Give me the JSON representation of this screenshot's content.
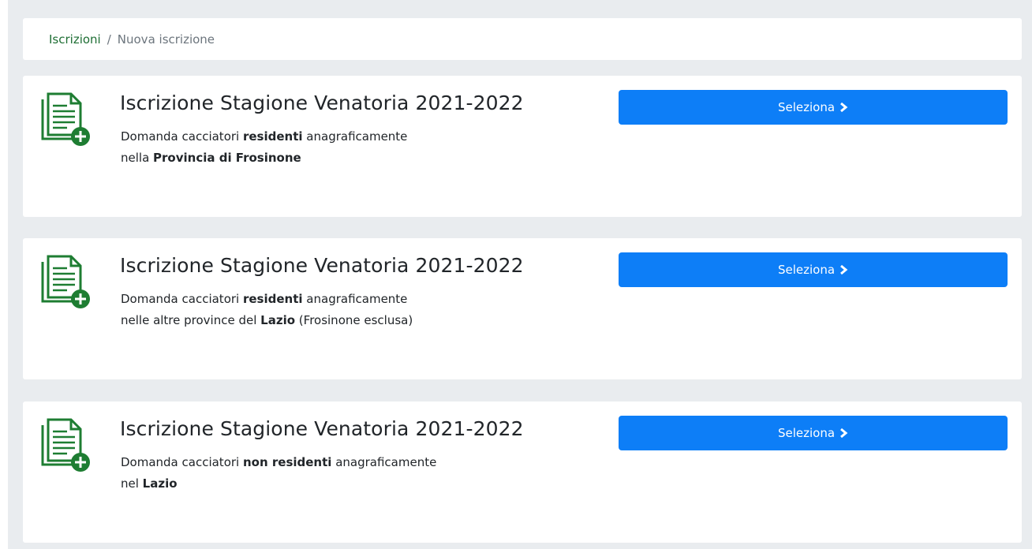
{
  "breadcrumb": {
    "link": "Iscrizioni",
    "separator": "/",
    "current": "Nuova iscrizione"
  },
  "cards": [
    {
      "title": "Iscrizione Stagione Venatoria 2021-2022",
      "desc_l1_a": "Domanda cacciatori ",
      "desc_l1_b": "residenti",
      "desc_l1_c": " anagraficamente",
      "desc_l2_a": "nella ",
      "desc_l2_b": "Provincia di Frosinone",
      "desc_l2_c": "",
      "button_label": "Seleziona"
    },
    {
      "title": "Iscrizione Stagione Venatoria 2021-2022",
      "desc_l1_a": "Domanda cacciatori ",
      "desc_l1_b": "residenti",
      "desc_l1_c": " anagraficamente",
      "desc_l2_a": "nelle altre province del ",
      "desc_l2_b": "Lazio",
      "desc_l2_c": " (Frosinone esclusa)",
      "button_label": "Seleziona"
    },
    {
      "title": "Iscrizione Stagione Venatoria 2021-2022",
      "desc_l1_a": "Domanda cacciatori ",
      "desc_l1_b": "non residenti",
      "desc_l1_c": " anagraficamente",
      "desc_l2_a": "nel ",
      "desc_l2_b": "Lazio",
      "desc_l2_c": "",
      "button_label": "Seleziona"
    }
  ],
  "icons": {
    "card": "document-add-icon",
    "button": "chevron-right-icon"
  },
  "colors": {
    "background": "#e9ecef",
    "card": "#ffffff",
    "button": "#0d7ef7",
    "icon_green": "#1e7d32",
    "breadcrumb_link": "#1e6e34"
  }
}
